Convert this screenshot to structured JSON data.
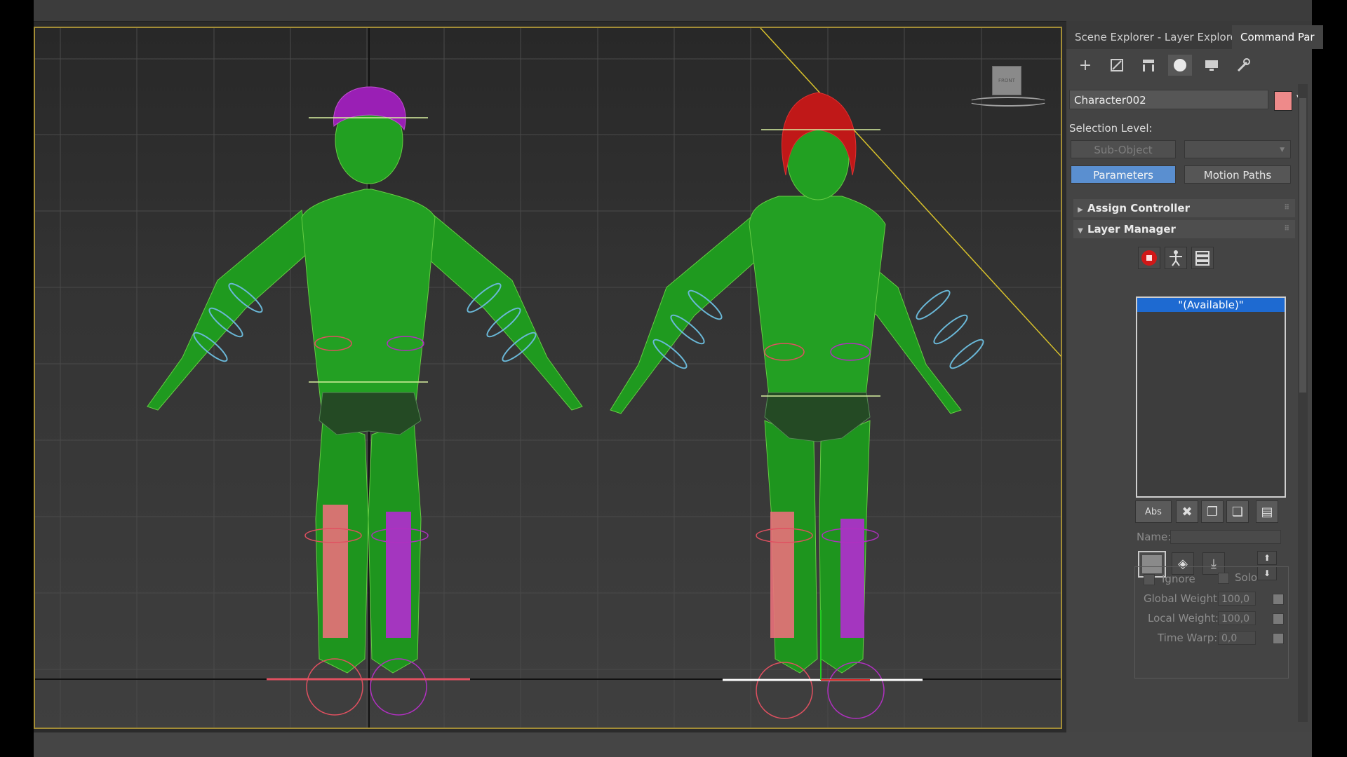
{
  "panel": {
    "tabs": [
      {
        "label": "Scene Explorer - Layer Explorer"
      },
      {
        "label": "Command Par"
      }
    ],
    "toolbar_icons": [
      "create-icon",
      "modify-icon",
      "hierarchy-icon",
      "motion-icon",
      "display-icon",
      "utilities-icon"
    ],
    "object_name": "Character002",
    "object_color": "#ee8a8a",
    "selection_level_label": "Selection Level:",
    "sub_object_button": "Sub-Object",
    "parameters_button": "Parameters",
    "motion_paths_button": "Motion Paths",
    "rollouts": {
      "assign_controller": "Assign Controller",
      "layer_manager": "Layer Manager"
    },
    "layer_list": {
      "selected_item": "\"(Available)\""
    },
    "abs_button": "Abs",
    "name_label": "Name:",
    "ignore_label": "Ignore",
    "solo_label": "Solo",
    "global_weight_label": "Global Weight:",
    "global_weight_value": "100,0",
    "local_weight_label": "Local Weight:",
    "local_weight_value": "100,0",
    "time_warp_label": "Time Warp:",
    "time_warp_value": "0,0"
  },
  "viewport": {
    "viewcube_label": "FRONT",
    "active_border_color": "#a38d36",
    "characters": [
      "male-character",
      "female-character"
    ]
  }
}
